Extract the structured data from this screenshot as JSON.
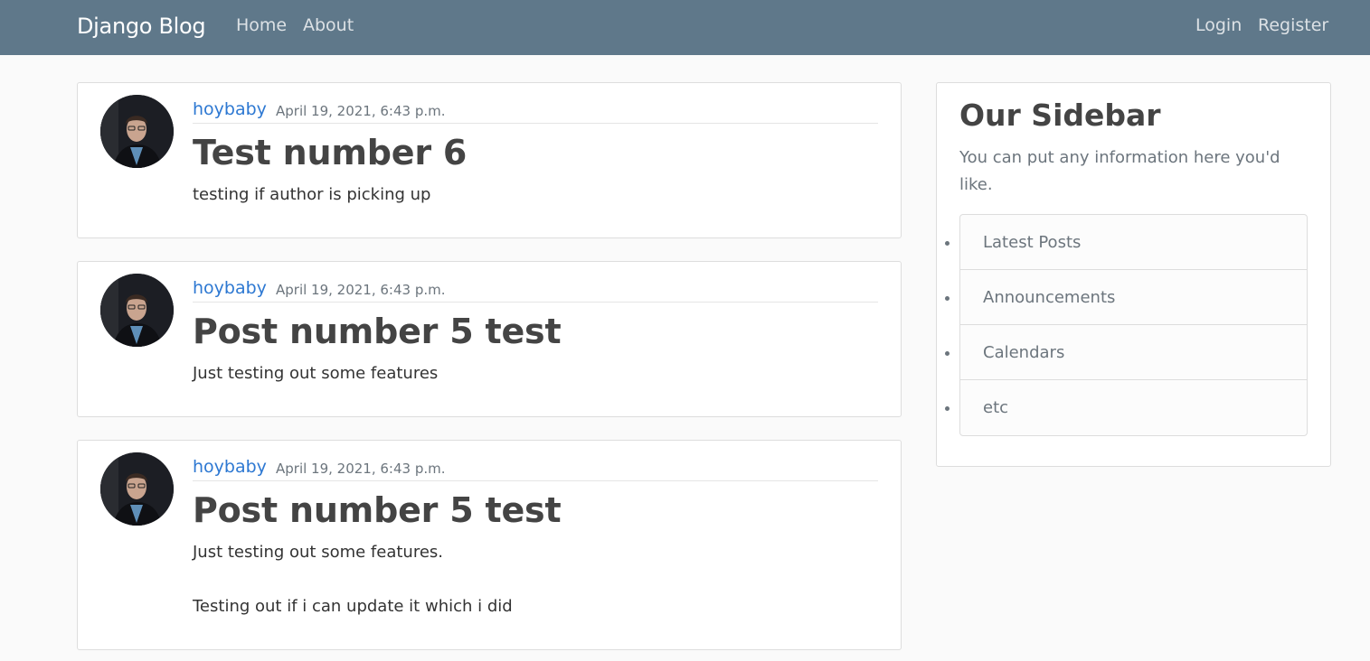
{
  "navbar": {
    "brand": "Django Blog",
    "left_links": [
      "Home",
      "About"
    ],
    "right_links": [
      "Login",
      "Register"
    ]
  },
  "posts": [
    {
      "author": "hoybaby",
      "date": "April 19, 2021, 6:43 p.m.",
      "title": "Test number 6",
      "content": [
        "testing if author is picking up"
      ]
    },
    {
      "author": "hoybaby",
      "date": "April 19, 2021, 6:43 p.m.",
      "title": "Post number 5 test",
      "content": [
        "Just testing out some features"
      ]
    },
    {
      "author": "hoybaby",
      "date": "April 19, 2021, 6:43 p.m.",
      "title": "Post number 5 test",
      "content": [
        "Just testing out some features.",
        "Testing out if i can update it which i did"
      ]
    }
  ],
  "sidebar": {
    "title": "Our Sidebar",
    "description": "You can put any information here you'd like.",
    "items": [
      "Latest Posts",
      "Announcements",
      "Calendars",
      "etc"
    ]
  },
  "colors": {
    "navbar_bg": "#5f788a",
    "link_blue": "#2d78d2",
    "page_bg": "#fafafa"
  },
  "icons": {
    "avatar": "user-profile-photo"
  }
}
